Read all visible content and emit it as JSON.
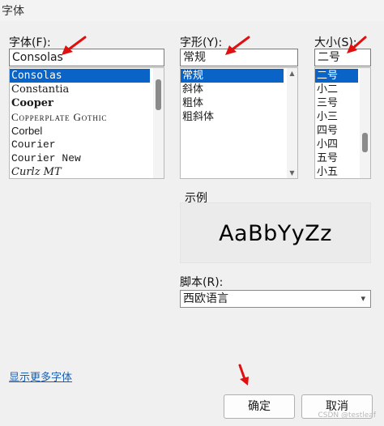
{
  "window": {
    "title": "字体"
  },
  "font": {
    "label": "字体(F):",
    "value": "Consolas",
    "items": [
      "Consolas",
      "Constantia",
      "Cooper",
      "Copperplate Gothic",
      "Corbel",
      "Courier",
      "Courier New",
      "Curlz MT"
    ]
  },
  "style": {
    "label": "字形(Y):",
    "value": "常规",
    "items": [
      "常规",
      "斜体",
      "粗体",
      "粗斜体"
    ]
  },
  "size": {
    "label": "大小(S):",
    "value": "二号",
    "items": [
      "二号",
      "小二",
      "三号",
      "小三",
      "四号",
      "小四",
      "五号",
      "小五"
    ]
  },
  "preview": {
    "label": "示例",
    "text": "AaBbYyZz"
  },
  "script": {
    "label": "脚本(R):",
    "value": "西欧语言"
  },
  "more_fonts_link": "显示更多字体",
  "buttons": {
    "ok": "确定",
    "cancel": "取消"
  },
  "watermark": "CSDN @testleaf",
  "colors": {
    "selection": "#0a64c8",
    "annotation_arrow": "#e01010"
  }
}
